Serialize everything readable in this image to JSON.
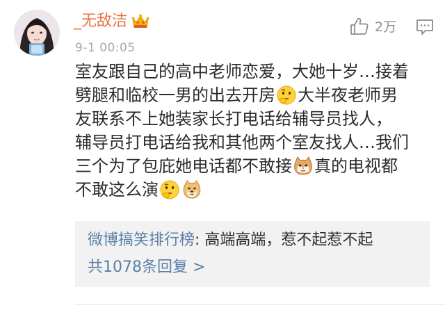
{
  "comment": {
    "username": "_无敌洁",
    "timestamp": "9-1 00:05",
    "like_count": "2万",
    "body_lines": [
      [
        "室友跟自己的高中老师恋爱，大她十岁…接着"
      ],
      [
        "劈腿和临校一男的出去开房",
        "大半夜老师男"
      ],
      [
        "友联系不上她装家长打电话给辅导员找人，"
      ],
      [
        "辅导员打电话给我和其他两个室友找人…我们"
      ],
      [
        "三个为了包庇她电话都不敢接",
        "真的电视都"
      ],
      [
        "不敢这么演"
      ]
    ],
    "emojis": [
      "thinking-emoji",
      "cat-emoji",
      "thinking-emoji",
      "doge-emoji"
    ]
  },
  "reply_preview": {
    "author": "微博搞笑排行榜",
    "separator": ": ",
    "text": "高端高端，惹不起惹不起",
    "count_label": "共1078条回复 >"
  },
  "icons": {
    "avatar": "avatar",
    "crown": "crown-icon",
    "like": "thumbs-up-icon",
    "reply": "comment-icon"
  },
  "colors": {
    "username": "#eb7340",
    "link": "#5b80a8",
    "muted": "#a8a8a8",
    "reply_bg": "#f2f2f2"
  }
}
